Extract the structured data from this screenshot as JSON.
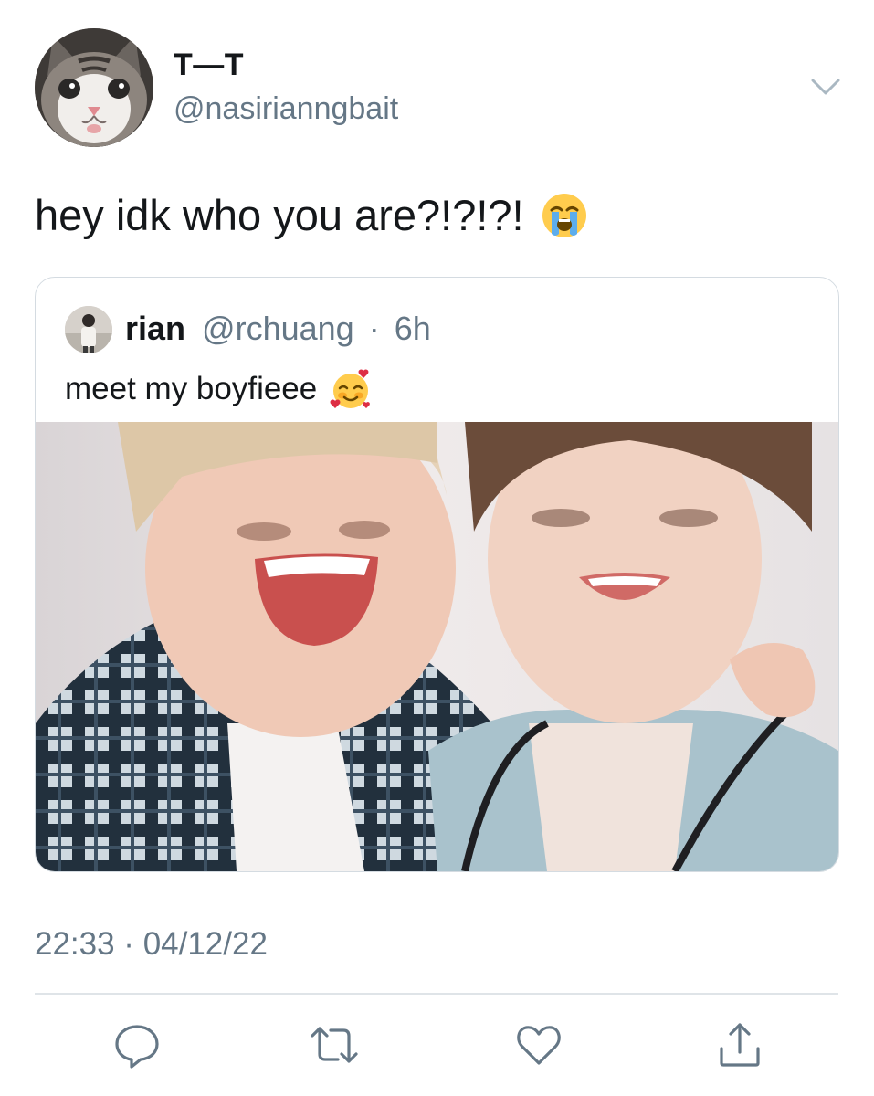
{
  "tweet": {
    "author": {
      "display_name": "T—T",
      "handle": "@nasirianngbait",
      "avatar_icon": "cat-avatar"
    },
    "text": "hey idk who you are?!?!?!",
    "text_emoji": "loudly-crying-face-emoji",
    "menu_icon": "chevron-down-icon",
    "quoted": {
      "display_name": "rian",
      "handle": "@rchuang",
      "separator": "·",
      "time": "6h",
      "text": "meet my boyfieee",
      "text_emoji": "smiling-face-with-hearts-emoji",
      "media_icon": "photo"
    },
    "timestamp": "22:33 · 04/12/22",
    "actions": [
      {
        "icon": "reply-icon"
      },
      {
        "icon": "retweet-icon"
      },
      {
        "icon": "like-icon"
      },
      {
        "icon": "share-icon"
      }
    ]
  },
  "colors": {
    "text": "#14171a",
    "secondary": "#657786",
    "border": "#d4dbe1",
    "divider": "#dfe4e8"
  }
}
